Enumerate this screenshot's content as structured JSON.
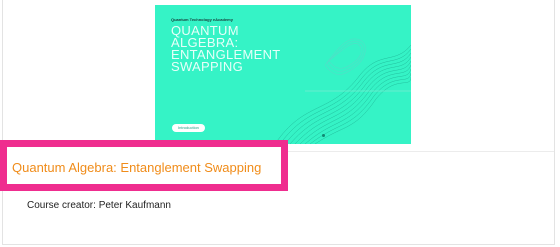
{
  "course_card": {
    "hero": {
      "brand_text": "Quantum Technology eAcademy",
      "title_lines": [
        "QUANTUM",
        "ALGEBRA:",
        "ENTANGLEMENT",
        "SWAPPING"
      ],
      "tag": "Introduction",
      "background_color": "#35f3c6"
    },
    "title": "Quantum Algebra: Entanglement Swapping",
    "creator_label": "Course creator: Peter Kaufmann",
    "highlight_color": "#ef2d8f",
    "title_color": "#f08c1a"
  }
}
